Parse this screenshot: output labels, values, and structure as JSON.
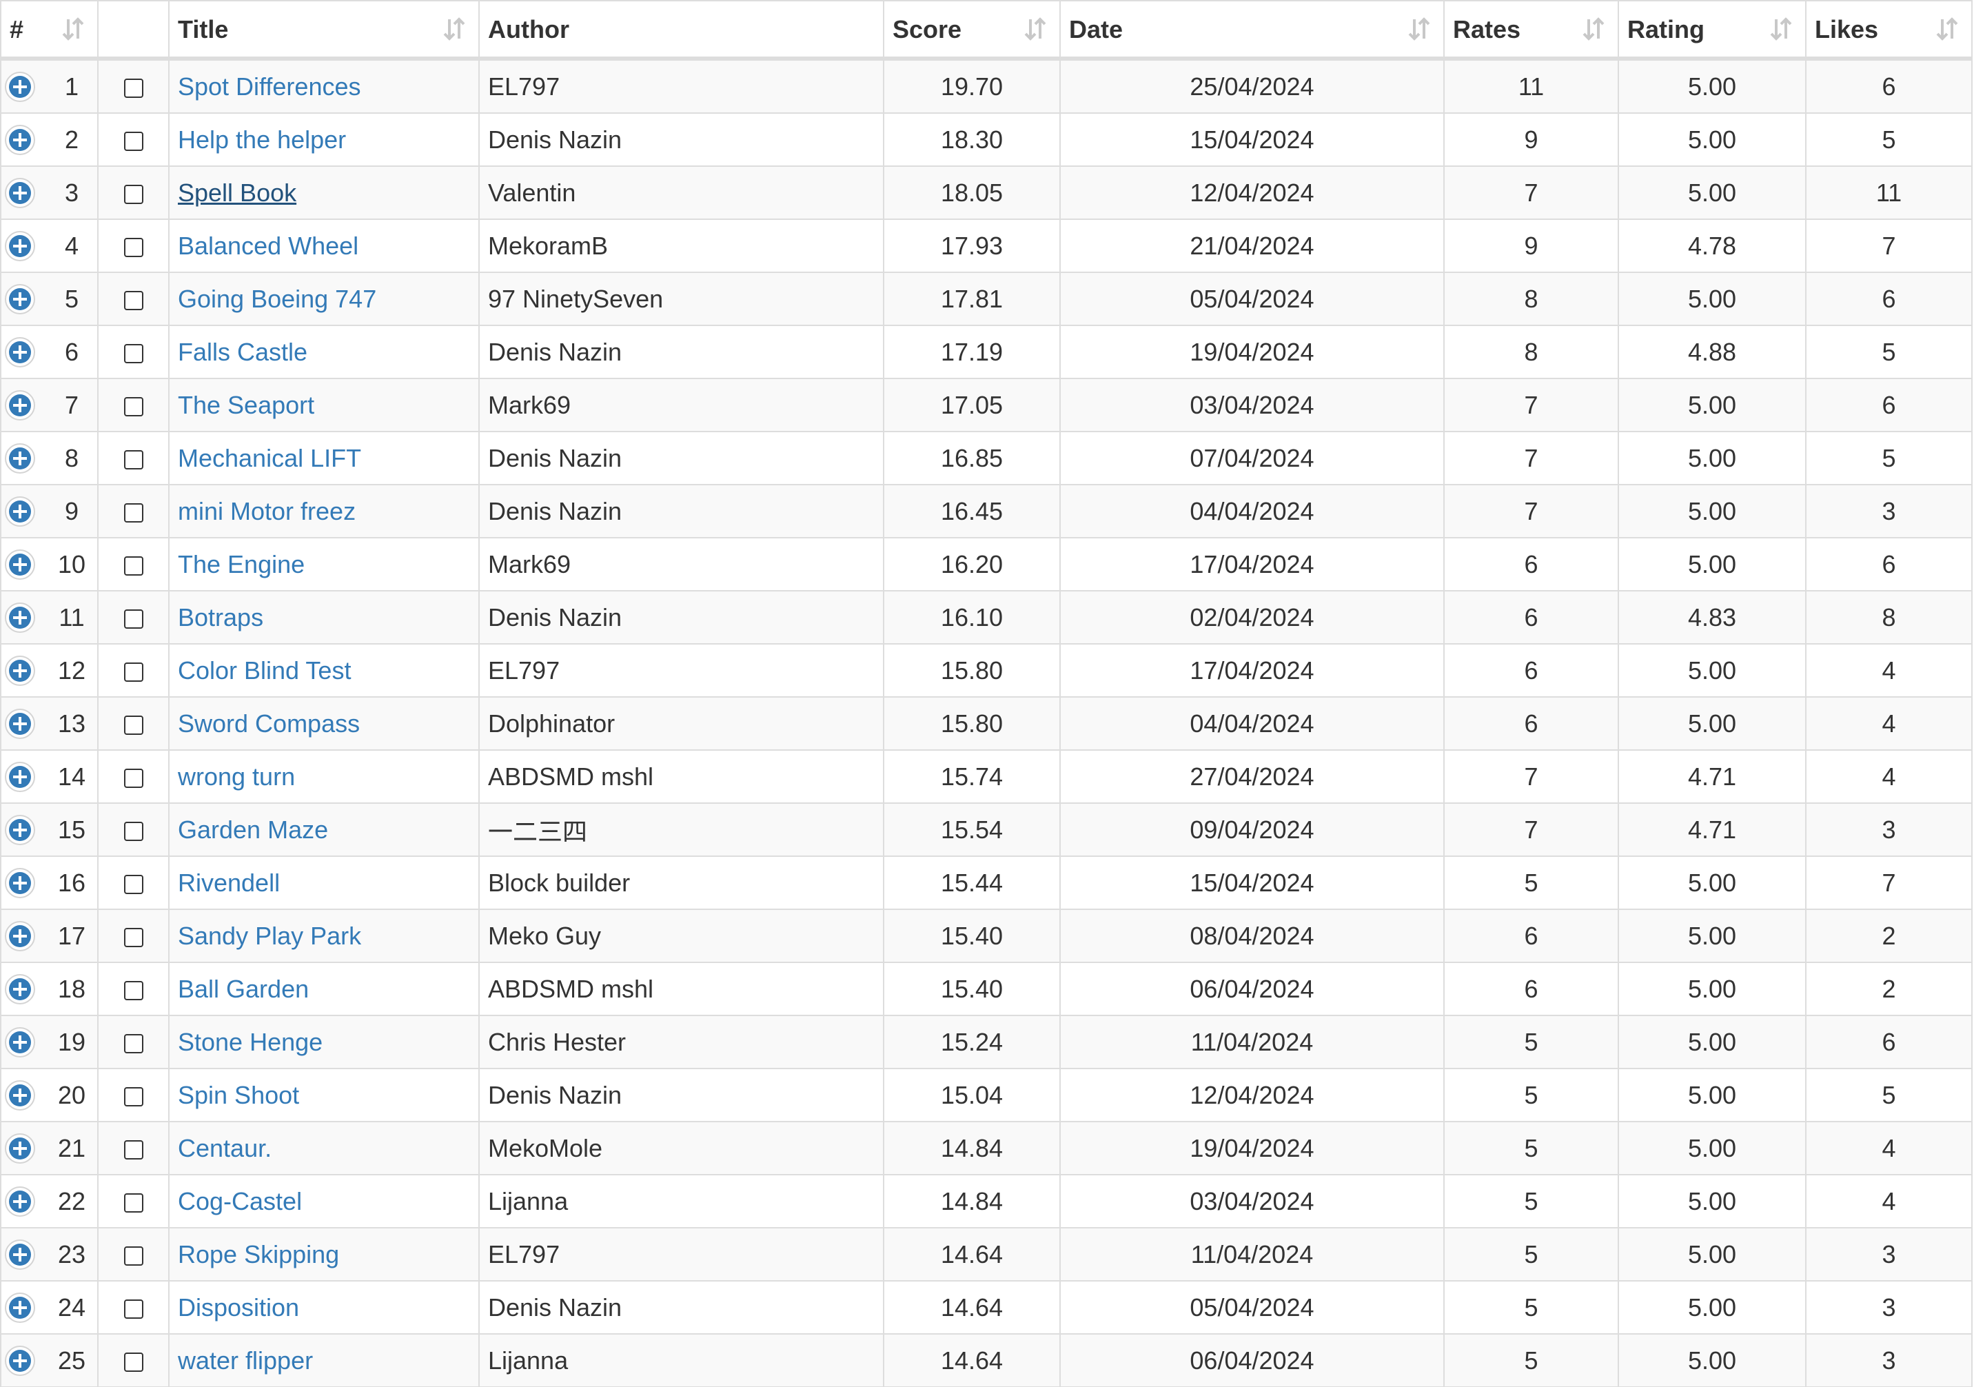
{
  "columns": [
    {
      "key": "num",
      "label": "#"
    },
    {
      "key": "check",
      "label": ""
    },
    {
      "key": "title",
      "label": "Title"
    },
    {
      "key": "author",
      "label": "Author"
    },
    {
      "key": "score",
      "label": "Score"
    },
    {
      "key": "date",
      "label": "Date"
    },
    {
      "key": "rates",
      "label": "Rates"
    },
    {
      "key": "rating",
      "label": "Rating"
    },
    {
      "key": "likes",
      "label": "Likes"
    }
  ],
  "colors": {
    "link": "#337ab7",
    "link_hover": "#23527c",
    "expand_icon": "#337ab7",
    "stripe": "#f9f9f9",
    "border": "#dddddd"
  },
  "icons": {
    "expand": "plus-circle-icon",
    "sort": "sort-arrows-icon",
    "check": "checkbox"
  },
  "hovered_row": 3,
  "rows": [
    {
      "num": "1",
      "title": "Spot Differences",
      "author": "EL797",
      "score": "19.70",
      "date": "25/04/2024",
      "rates": "11",
      "rating": "5.00",
      "likes": "6"
    },
    {
      "num": "2",
      "title": "Help the helper",
      "author": "Denis Nazin",
      "score": "18.30",
      "date": "15/04/2024",
      "rates": "9",
      "rating": "5.00",
      "likes": "5"
    },
    {
      "num": "3",
      "title": "Spell Book",
      "author": "Valentin",
      "score": "18.05",
      "date": "12/04/2024",
      "rates": "7",
      "rating": "5.00",
      "likes": "11"
    },
    {
      "num": "4",
      "title": "Balanced Wheel",
      "author": "MekoramB",
      "score": "17.93",
      "date": "21/04/2024",
      "rates": "9",
      "rating": "4.78",
      "likes": "7"
    },
    {
      "num": "5",
      "title": "Going Boeing 747",
      "author": "97 NinetySeven",
      "score": "17.81",
      "date": "05/04/2024",
      "rates": "8",
      "rating": "5.00",
      "likes": "6"
    },
    {
      "num": "6",
      "title": "Falls Castle",
      "author": "Denis Nazin",
      "score": "17.19",
      "date": "19/04/2024",
      "rates": "8",
      "rating": "4.88",
      "likes": "5"
    },
    {
      "num": "7",
      "title": "The Seaport",
      "author": "Mark69",
      "score": "17.05",
      "date": "03/04/2024",
      "rates": "7",
      "rating": "5.00",
      "likes": "6"
    },
    {
      "num": "8",
      "title": "Mechanical LIFT",
      "author": "Denis Nazin",
      "score": "16.85",
      "date": "07/04/2024",
      "rates": "7",
      "rating": "5.00",
      "likes": "5"
    },
    {
      "num": "9",
      "title": "mini Motor freez",
      "author": "Denis Nazin",
      "score": "16.45",
      "date": "04/04/2024",
      "rates": "7",
      "rating": "5.00",
      "likes": "3"
    },
    {
      "num": "10",
      "title": "The Engine",
      "author": "Mark69",
      "score": "16.20",
      "date": "17/04/2024",
      "rates": "6",
      "rating": "5.00",
      "likes": "6"
    },
    {
      "num": "11",
      "title": "Botraps",
      "author": "Denis Nazin",
      "score": "16.10",
      "date": "02/04/2024",
      "rates": "6",
      "rating": "4.83",
      "likes": "8"
    },
    {
      "num": "12",
      "title": "Color Blind Test",
      "author": "EL797",
      "score": "15.80",
      "date": "17/04/2024",
      "rates": "6",
      "rating": "5.00",
      "likes": "4"
    },
    {
      "num": "13",
      "title": "Sword Compass",
      "author": "Dolphinator",
      "score": "15.80",
      "date": "04/04/2024",
      "rates": "6",
      "rating": "5.00",
      "likes": "4"
    },
    {
      "num": "14",
      "title": "wrong turn",
      "author": "ABDSMD mshl",
      "score": "15.74",
      "date": "27/04/2024",
      "rates": "7",
      "rating": "4.71",
      "likes": "4"
    },
    {
      "num": "15",
      "title": "Garden Maze",
      "author": "一二三四",
      "score": "15.54",
      "date": "09/04/2024",
      "rates": "7",
      "rating": "4.71",
      "likes": "3"
    },
    {
      "num": "16",
      "title": "Rivendell",
      "author": "Block builder",
      "score": "15.44",
      "date": "15/04/2024",
      "rates": "5",
      "rating": "5.00",
      "likes": "7"
    },
    {
      "num": "17",
      "title": "Sandy Play Park",
      "author": "Meko Guy",
      "score": "15.40",
      "date": "08/04/2024",
      "rates": "6",
      "rating": "5.00",
      "likes": "2"
    },
    {
      "num": "18",
      "title": "Ball Garden",
      "author": "ABDSMD mshl",
      "score": "15.40",
      "date": "06/04/2024",
      "rates": "6",
      "rating": "5.00",
      "likes": "2"
    },
    {
      "num": "19",
      "title": "Stone Henge",
      "author": "Chris Hester",
      "score": "15.24",
      "date": "11/04/2024",
      "rates": "5",
      "rating": "5.00",
      "likes": "6"
    },
    {
      "num": "20",
      "title": "Spin Shoot",
      "author": "Denis Nazin",
      "score": "15.04",
      "date": "12/04/2024",
      "rates": "5",
      "rating": "5.00",
      "likes": "5"
    },
    {
      "num": "21",
      "title": "Centaur.",
      "author": "MekoMole",
      "score": "14.84",
      "date": "19/04/2024",
      "rates": "5",
      "rating": "5.00",
      "likes": "4"
    },
    {
      "num": "22",
      "title": "Cog-Castel",
      "author": "Lijanna",
      "score": "14.84",
      "date": "03/04/2024",
      "rates": "5",
      "rating": "5.00",
      "likes": "4"
    },
    {
      "num": "23",
      "title": "Rope Skipping",
      "author": "EL797",
      "score": "14.64",
      "date": "11/04/2024",
      "rates": "5",
      "rating": "5.00",
      "likes": "3"
    },
    {
      "num": "24",
      "title": "Disposition",
      "author": "Denis Nazin",
      "score": "14.64",
      "date": "05/04/2024",
      "rates": "5",
      "rating": "5.00",
      "likes": "3"
    },
    {
      "num": "25",
      "title": "water flipper",
      "author": "Lijanna",
      "score": "14.64",
      "date": "06/04/2024",
      "rates": "5",
      "rating": "5.00",
      "likes": "3"
    }
  ]
}
